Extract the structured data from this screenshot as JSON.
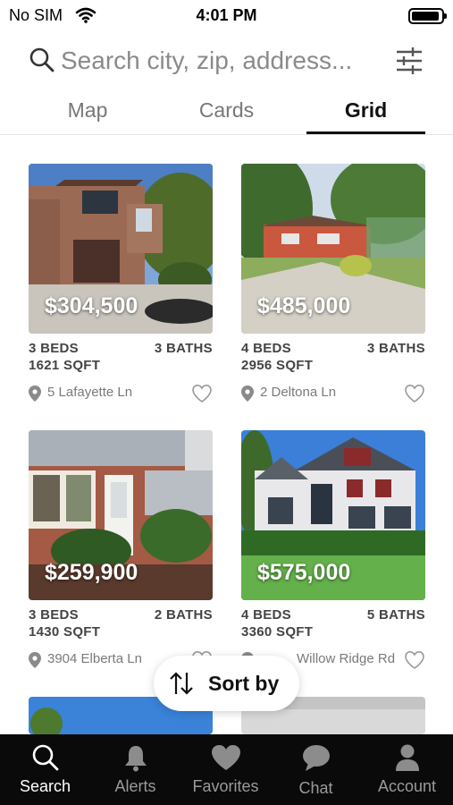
{
  "status_bar": {
    "carrier": "No SIM",
    "time": "4:01 PM"
  },
  "search": {
    "placeholder": "Search city, zip, address..."
  },
  "tabs": [
    {
      "label": "Map",
      "active": false
    },
    {
      "label": "Cards",
      "active": false
    },
    {
      "label": "Grid",
      "active": true
    }
  ],
  "listings": [
    {
      "price": "$304,500",
      "beds": "3 BEDS",
      "baths": "3 BATHS",
      "sqft": "1621 SQFT",
      "address": "5 Lafayette Ln"
    },
    {
      "price": "$485,000",
      "beds": "4 BEDS",
      "baths": "3 BATHS",
      "sqft": "2956 SQFT",
      "address": "2 Deltona Ln"
    },
    {
      "price": "$259,900",
      "beds": "3 BEDS",
      "baths": "2 BATHS",
      "sqft": "1430 SQFT",
      "address": "3904 Elberta Ln"
    },
    {
      "price": "$575,000",
      "beds": "4 BEDS",
      "baths": "5 BATHS",
      "sqft": "3360 SQFT",
      "address": "Willow Ridge Rd"
    }
  ],
  "sort": {
    "label": "Sort by"
  },
  "bottom_nav": [
    {
      "label": "Search",
      "icon": "search-icon",
      "active": true
    },
    {
      "label": "Alerts",
      "icon": "bell-icon",
      "active": false
    },
    {
      "label": "Favorites",
      "icon": "heart-icon",
      "active": false
    },
    {
      "label": "Chat",
      "icon": "chat-bubble-icon",
      "active": false
    },
    {
      "label": "Account",
      "icon": "person-icon",
      "active": false
    }
  ],
  "colors": {
    "active_tab": "#111111",
    "nav_background": "#0a0a0a",
    "nav_inactive": "#9a9a9a"
  }
}
